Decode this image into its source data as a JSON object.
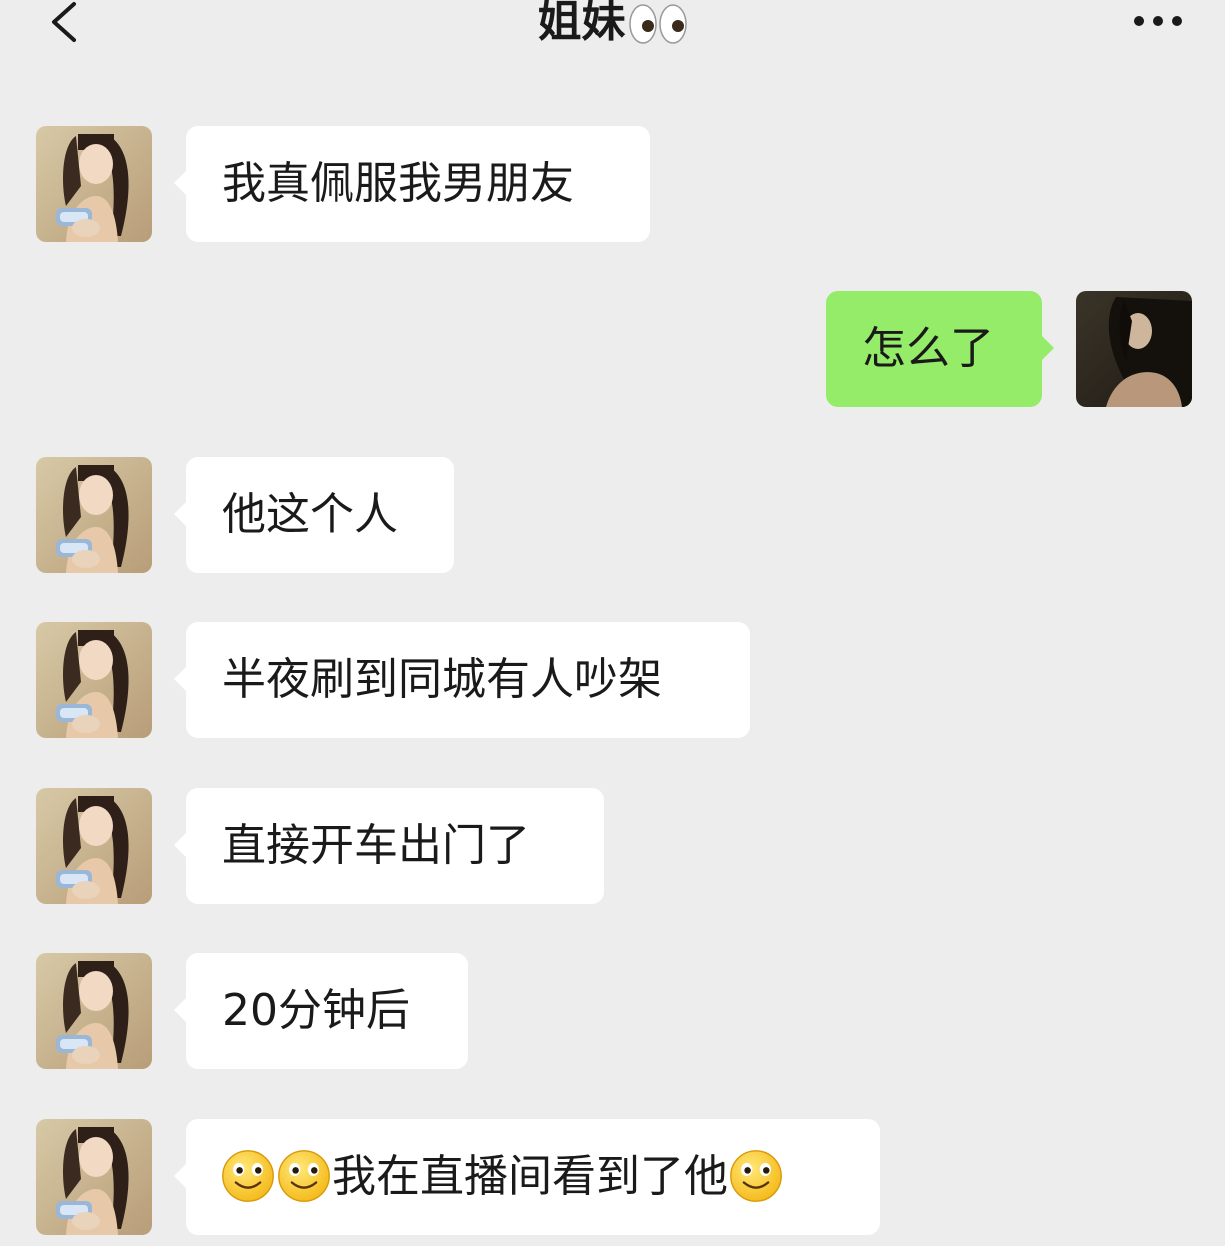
{
  "header": {
    "title": "姐妹",
    "title_emoji": "eyes-emoji",
    "back_icon": "chevron-left-icon",
    "more_icon": "more-dots-icon"
  },
  "messages": [
    {
      "side": "left",
      "text": "我真佩服我男朋友"
    },
    {
      "side": "right",
      "text": "怎么了"
    },
    {
      "side": "left",
      "text": "他这个人"
    },
    {
      "side": "left",
      "text": "半夜刷到同城有人吵架"
    },
    {
      "side": "left",
      "text": "直接开车出门了"
    },
    {
      "side": "left",
      "text": "20分钟后"
    },
    {
      "side": "left",
      "text": "我在直播间看到了他",
      "prefix_emoji": [
        "smile-emoji",
        "smile-emoji"
      ],
      "suffix_emoji": [
        "smile-emoji"
      ]
    }
  ],
  "colors": {
    "background": "#ededed",
    "bubble_left": "#ffffff",
    "bubble_right": "#95ec69"
  }
}
